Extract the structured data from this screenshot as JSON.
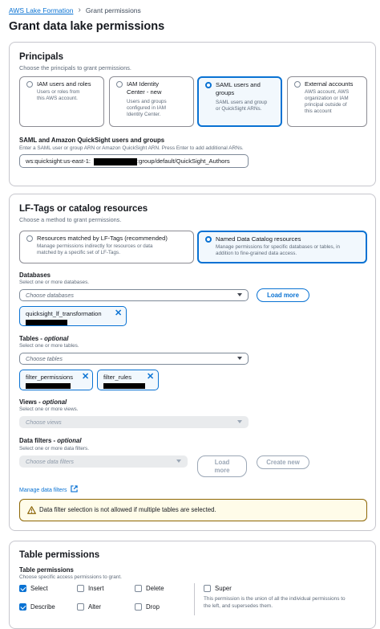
{
  "breadcrumb": {
    "root": "AWS Lake Formation",
    "current": "Grant permissions"
  },
  "page_title": "Grant data lake permissions",
  "principals": {
    "title": "Principals",
    "desc": "Choose the principals to grant permissions.",
    "options": [
      {
        "label": "IAM users and roles",
        "desc": [
          "Users or roles from",
          "this AWS account."
        ]
      },
      {
        "label1": "IAM Identity",
        "label2": "Center - new",
        "desc": [
          "Users and groups",
          "configured in IAM",
          "Identity Center."
        ]
      },
      {
        "label1": "SAML users and",
        "label2": "groups",
        "desc": [
          "SAML users and group",
          "or QuickSight ARNs."
        ]
      },
      {
        "label": "External accounts",
        "desc": [
          "AWS account, AWS",
          "organization or IAM",
          "principal outside of",
          "this account"
        ]
      }
    ],
    "saml_label": "SAML and Amazon QuickSight users and groups",
    "saml_desc": "Enter a SAML user or group ARN or Amazon QuickSight ARN. Press Enter to add additional ARNs.",
    "saml_value_prefix": "ws:quicksight:us-east-1:",
    "saml_value_suffix": ":group/default/QuickSight_Authors"
  },
  "resources": {
    "title": "LF-Tags or catalog resources",
    "desc": "Choose a method to grant permissions.",
    "opt1_label": "Resources matched by LF-Tags (recommended)",
    "opt1_desc": [
      "Manage permissions indirectly for resources or data",
      "matched by a specific set of LF-Tags."
    ],
    "opt2_label": "Named Data Catalog resources",
    "opt2_desc": [
      "Manage permissions for specific databases or tables, in",
      "addition to fine-grained data access."
    ],
    "db_label": "Databases",
    "db_desc": "Select one or more databases.",
    "db_placeholder": "Choose databases",
    "load_more": "Load more",
    "db_token": "quicksight_lf_transformation",
    "tables_label": "Tables - ",
    "tables_opt": "optional",
    "tables_desc": "Select one or more tables.",
    "tables_placeholder": "Choose tables",
    "table_tokens": [
      "filter_permissions",
      "filter_rules"
    ],
    "views_label": "Views - ",
    "views_opt": "optional",
    "views_desc": "Select one or more views.",
    "views_placeholder": "Choose views",
    "df_label": "Data filters - ",
    "df_opt": "optional",
    "df_desc": "Select one or more data filters.",
    "df_placeholder": "Choose data filters",
    "df_load1": "Load",
    "df_load2": "more",
    "create_new": "Create new",
    "manage_link": "Manage data filters",
    "alert": "Data filter selection is not allowed if multiple tables are selected."
  },
  "table_perms": {
    "title": "Table permissions",
    "sub_label": "Table permissions",
    "sub_desc": "Choose specific access permissions to grant.",
    "items": [
      {
        "label": "Select",
        "checked": true
      },
      {
        "label": "Insert",
        "checked": false
      },
      {
        "label": "Delete",
        "checked": false
      },
      {
        "label": "Describe",
        "checked": true
      },
      {
        "label": "Alter",
        "checked": false
      },
      {
        "label": "Drop",
        "checked": false
      }
    ],
    "super_label": "Super",
    "super_desc": [
      "This permission is the union of all the individual permissions to",
      "the left, and supersedes them."
    ]
  },
  "colors": {
    "accent": "#0972d3",
    "warning": "#8d6605"
  }
}
